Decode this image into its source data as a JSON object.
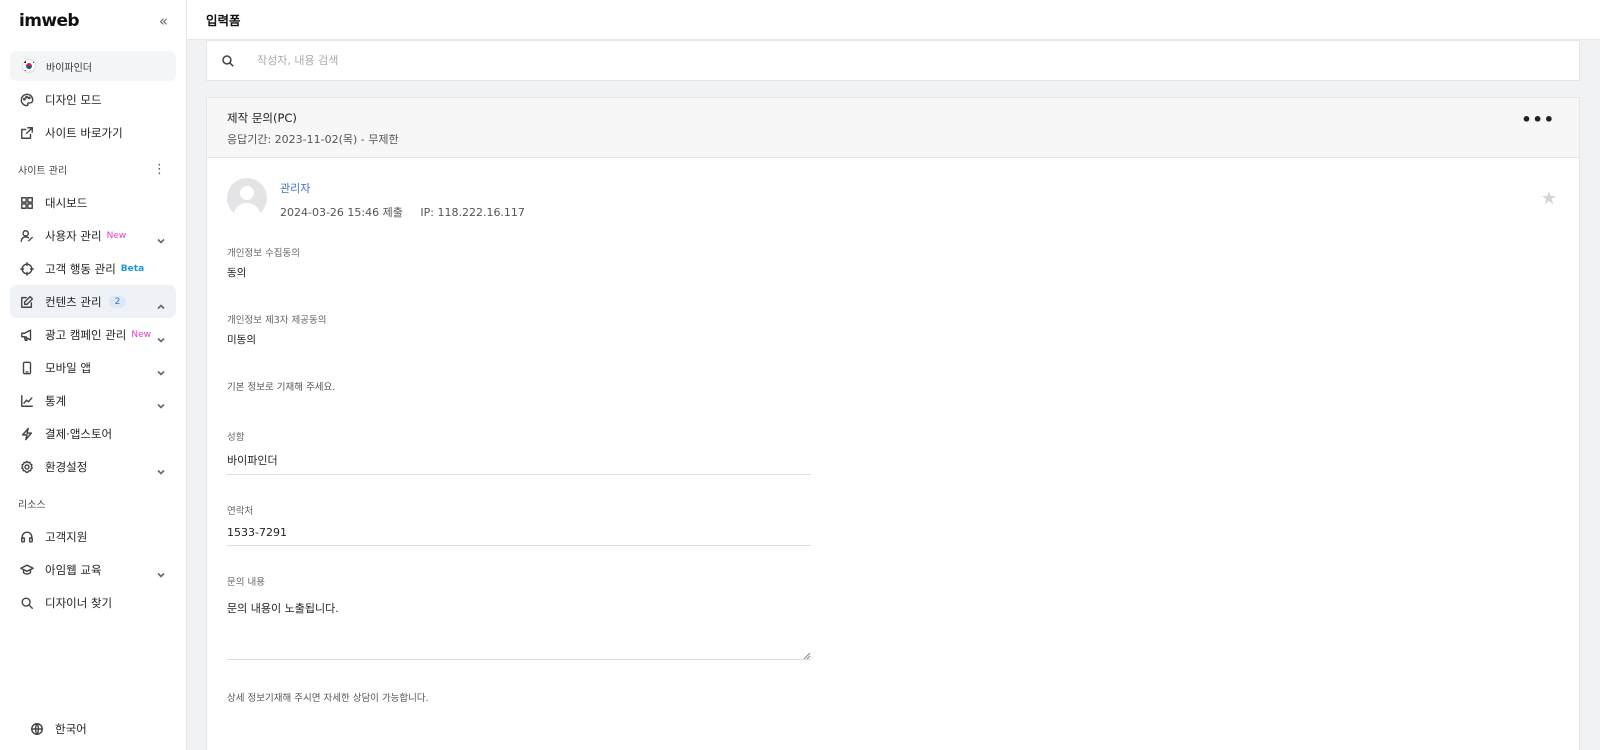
{
  "sidebar": {
    "logo": "imweb",
    "collapse_icon": "«",
    "site_name": "바이파인더",
    "top_items": [
      {
        "label": "디자인 모드",
        "icon": "palette-icon"
      },
      {
        "label": "사이트 바로가기",
        "icon": "external-link-icon"
      }
    ],
    "section_site": "사이트 관리",
    "section_kebab": "⋮",
    "site_items": [
      {
        "label": "대시보드",
        "icon": "grid-icon"
      },
      {
        "label": "사용자 관리",
        "badge": "New",
        "icon": "user-icon"
      },
      {
        "label": "고객 행동 관리",
        "badge": "Beta",
        "icon": "crosshair-icon"
      },
      {
        "label": "컨텐츠 관리",
        "count": "2",
        "icon": "edit-icon",
        "active": true
      },
      {
        "label": "광고 캠페인 관리",
        "badge": "New",
        "icon": "megaphone-icon"
      },
      {
        "label": "모바일 앱",
        "icon": "mobile-icon"
      },
      {
        "label": "통계",
        "icon": "chart-icon"
      },
      {
        "label": "결제·앱스토어",
        "icon": "bolt-icon"
      },
      {
        "label": "환경설정",
        "icon": "gear-icon"
      }
    ],
    "section_resource": "리소스",
    "resource_items": [
      {
        "label": "고객지원",
        "icon": "headset-icon"
      },
      {
        "label": "아임웹 교육",
        "icon": "graduation-icon"
      },
      {
        "label": "디자이너 찾기",
        "icon": "search-icon"
      }
    ],
    "language": "한국어"
  },
  "topbar": {
    "title": "입력폼"
  },
  "search": {
    "placeholder": "작성자, 내용 검색"
  },
  "form": {
    "title": "제작 문의(PC)",
    "period": "응답기간: 2023-11-02(목) - 무제한",
    "more": "•••",
    "author": {
      "name": "관리자",
      "submitted": "2024-03-26 15:46 제출",
      "ip": "IP: 118.222.16.117"
    },
    "star": "★",
    "consent1": {
      "label": "개인정보 수집동의",
      "value": "동의"
    },
    "consent2": {
      "label": "개인정보 제3자 제공동의",
      "value": "미동의"
    },
    "note1": "기본 정보로 기재해 주세요.",
    "name_field": {
      "label": "성함",
      "value": "바이파인더"
    },
    "phone_field": {
      "label": "연락처",
      "value": "1533-7291"
    },
    "inquiry_field": {
      "label": "문의 내용",
      "value": "문의 내용이 노출됩니다."
    },
    "note2": "상세 정보기재해 주시면 자세한 상담이 가능합니다."
  }
}
